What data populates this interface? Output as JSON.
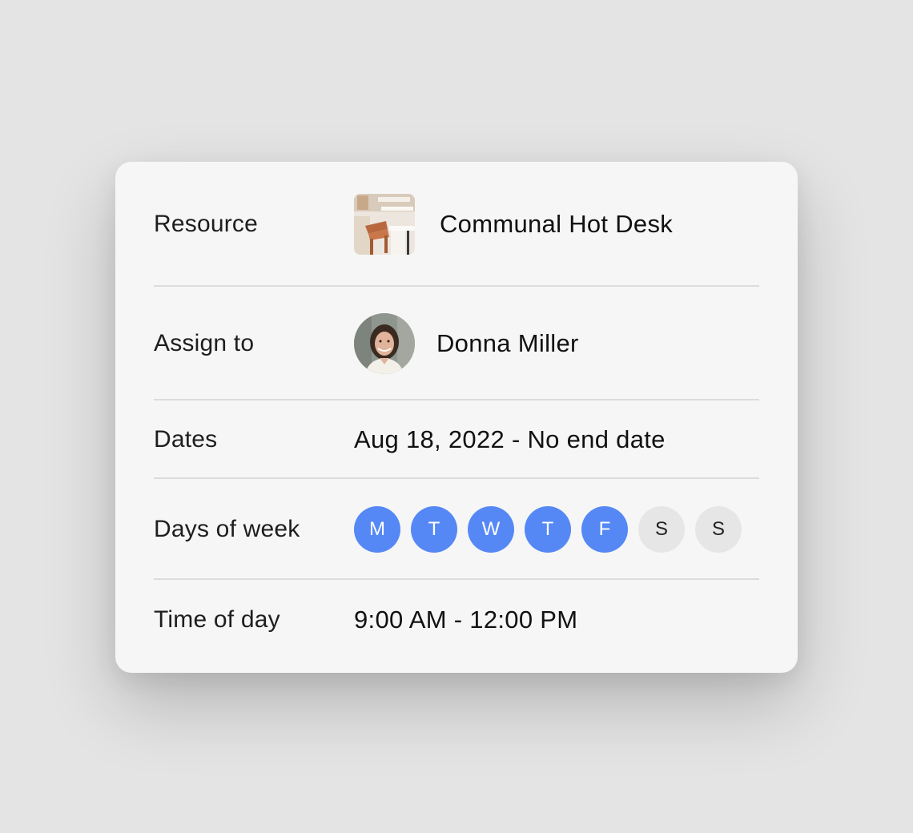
{
  "resource": {
    "label": "Resource",
    "value": "Communal Hot Desk",
    "thumbnail_icon": "desk-chair-photo"
  },
  "assign": {
    "label": "Assign to",
    "value": "Donna Miller",
    "avatar_icon": "person-avatar"
  },
  "dates": {
    "label": "Dates",
    "value": "Aug 18, 2022 - No end date"
  },
  "days_of_week": {
    "label": "Days of week",
    "days": [
      {
        "letter": "M",
        "selected": true
      },
      {
        "letter": "T",
        "selected": true
      },
      {
        "letter": "W",
        "selected": true
      },
      {
        "letter": "T",
        "selected": true
      },
      {
        "letter": "F",
        "selected": true
      },
      {
        "letter": "S",
        "selected": false
      },
      {
        "letter": "S",
        "selected": false
      }
    ]
  },
  "time_of_day": {
    "label": "Time of day",
    "value": "9:00 AM - 12:00 PM"
  },
  "colors": {
    "selected_day": "#5588f5",
    "unselected_day": "#e6e6e6",
    "card": "#f6f6f6",
    "background": "#e4e4e4"
  }
}
